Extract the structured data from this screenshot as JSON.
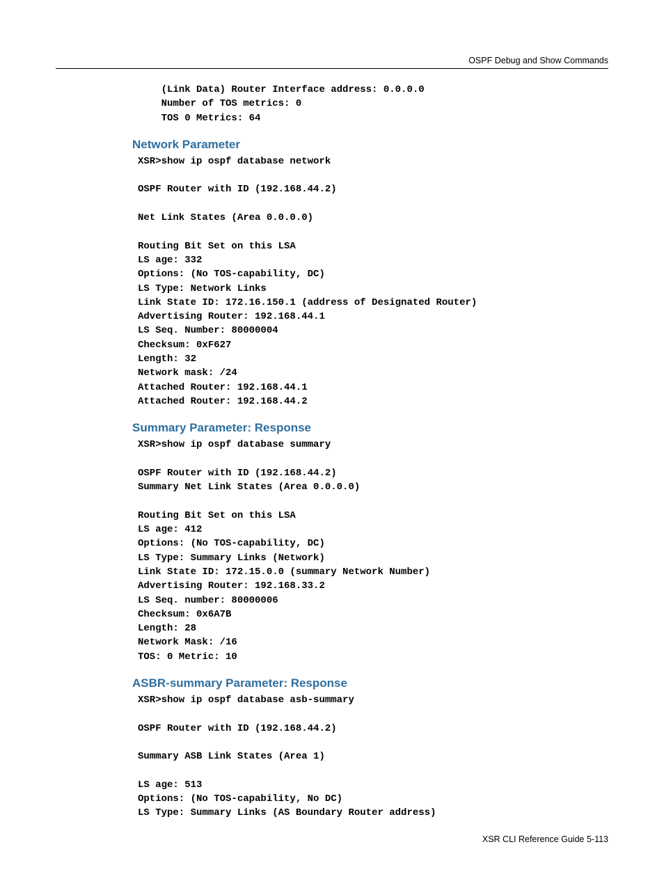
{
  "header": {
    "title": "OSPF Debug and Show Commands"
  },
  "intro_block": "    (Link Data) Router Interface address: 0.0.0.0\n    Number of TOS metrics: 0\n    TOS 0 Metrics: 64",
  "sections": {
    "network": {
      "title": "Network Parameter",
      "block1": "XSR>show ip ospf database network\n\nOSPF Router with ID (192.168.44.2)\n\nNet Link States (Area 0.0.0.0)\n\nRouting Bit Set on this LSA\nLS age: 332\nOptions: (No TOS-capability, DC)\nLS Type: Network Links\nLink State ID: 172.16.150.1 (address of Designated Router)\nAdvertising Router: 192.168.44.1\nLS Seq. Number: 80000004\nChecksum: 0xF627\nLength: 32\nNetwork mask: /24\nAttached Router: 192.168.44.1\nAttached Router: 192.168.44.2"
    },
    "summary": {
      "title": "Summary Parameter: Response",
      "block1": "XSR>show ip ospf database summary\n\nOSPF Router with ID (192.168.44.2)\nSummary Net Link States (Area 0.0.0.0)\n\nRouting Bit Set on this LSA\nLS age: 412\nOptions: (No TOS-capability, DC)\nLS Type: Summary Links (Network)\nLink State ID: 172.15.0.0 (summary Network Number)\nAdvertising Router: 192.168.33.2\nLS Seq. number: 80000006\nChecksum: 0x6A7B\nLength: 28\nNetwork Mask: /16\nTOS: 0 Metric: 10"
    },
    "asbr": {
      "title": "ASBR-summary Parameter: Response",
      "block1": "XSR>show ip ospf database asb-summary\n\nOSPF Router with ID (192.168.44.2)\n\nSummary ASB Link States (Area 1)\n\nLS age: 513\nOptions: (No TOS-capability, No DC)\nLS Type: Summary Links (AS Boundary Router address)"
    }
  },
  "footer": {
    "text": "XSR CLI Reference Guide   5-113"
  }
}
